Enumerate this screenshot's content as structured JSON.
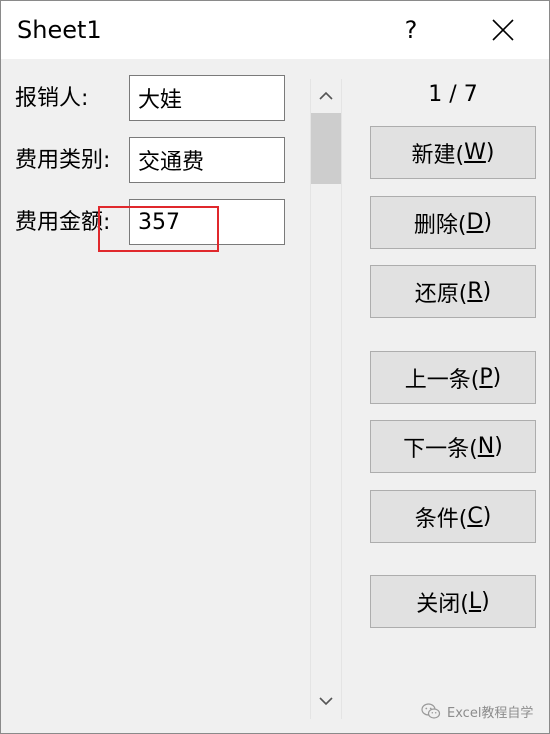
{
  "window": {
    "title": "Sheet1",
    "help_label": "?"
  },
  "fields": [
    {
      "label": "报销人:",
      "value": "大娃"
    },
    {
      "label": "费用类别:",
      "value": "交通费"
    },
    {
      "label": "费用金额:",
      "value": "357"
    }
  ],
  "record_counter": "1 / 7",
  "buttons": {
    "new": {
      "text": "新建(",
      "key": "W",
      "end": ")"
    },
    "delete": {
      "text": "删除(",
      "key": "D",
      "end": ")"
    },
    "restore": {
      "text": "还原(",
      "key": "R",
      "end": ")"
    },
    "prev": {
      "text": "上一条(",
      "key": "P",
      "end": ")"
    },
    "next": {
      "text": "下一条(",
      "key": "N",
      "end": ")"
    },
    "criteria": {
      "text": "条件(",
      "key": "C",
      "end": ")"
    },
    "close": {
      "text": "关闭(",
      "key": "L",
      "end": ")"
    }
  },
  "watermark": {
    "text": "Excel教程自学",
    "icon": "wechat-icon"
  },
  "colors": {
    "highlight": "#e0282c",
    "window_bg": "#f0f0f0",
    "button_bg": "#e1e1e1"
  }
}
